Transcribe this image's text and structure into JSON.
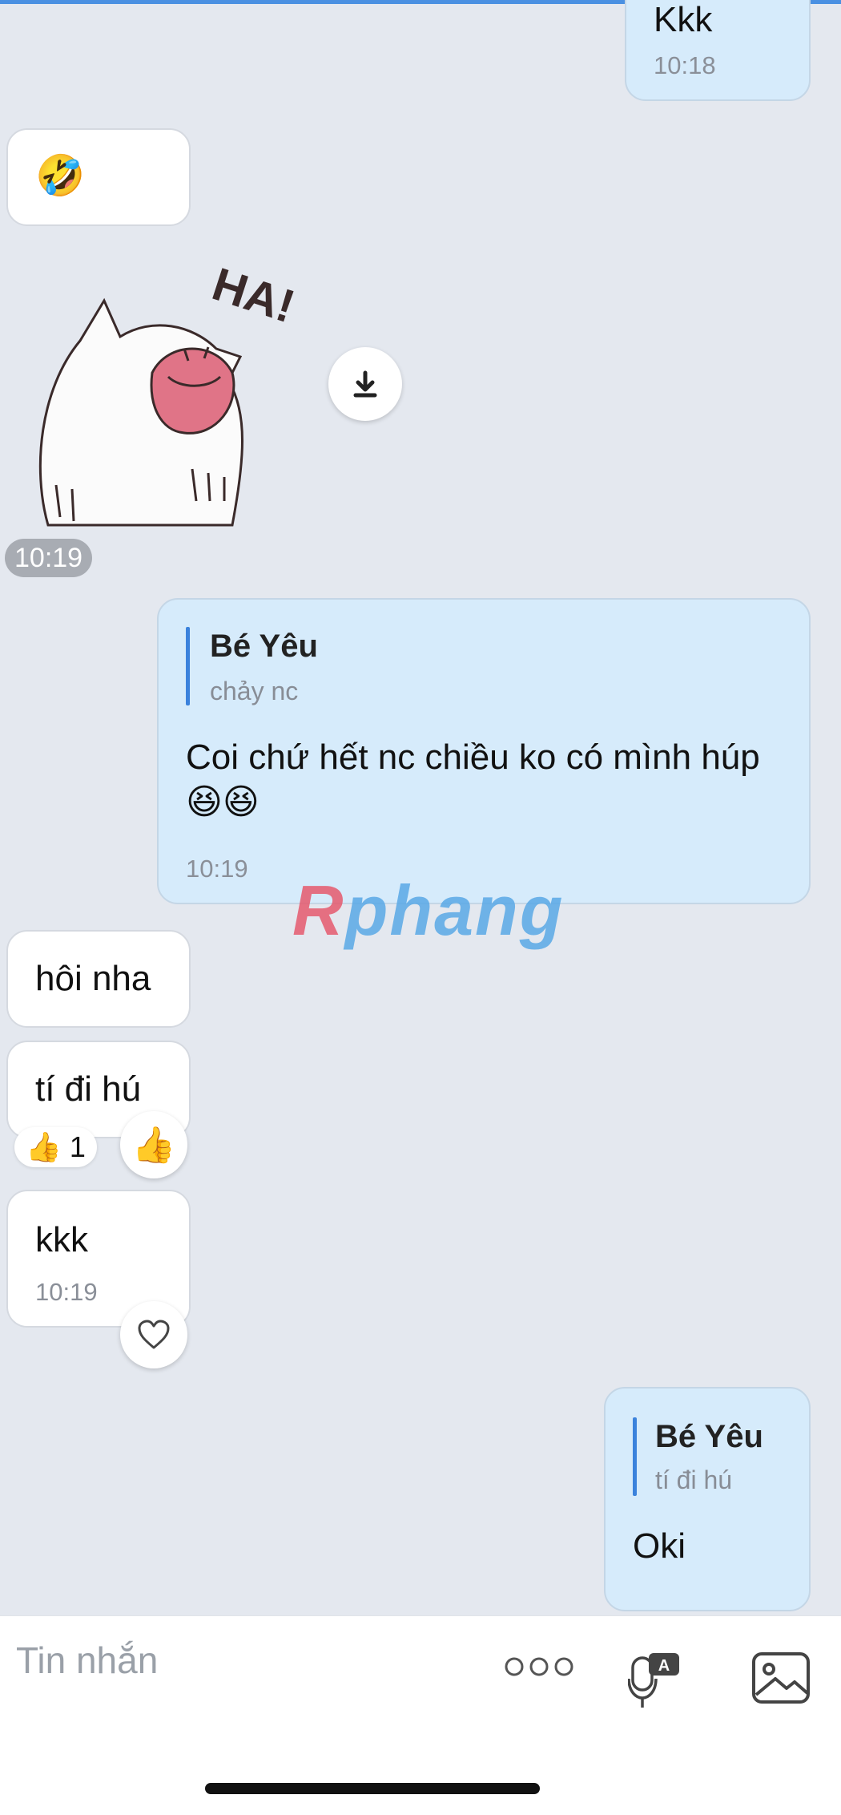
{
  "messages": {
    "m1": {
      "text": "Kkk",
      "time": "10:18"
    },
    "m2": {
      "emoji": "🤣"
    },
    "sticker": {
      "caption": "HA!",
      "time": "10:19"
    },
    "m3": {
      "quote_name": "Bé Yêu",
      "quote_text": "chảy nc",
      "text": "Coi chứ hết nc chiều ko có mình húp",
      "emoji": "😆😆",
      "time": "10:19"
    },
    "m4": {
      "text": "hôi nha"
    },
    "m5": {
      "text": "tí đi hú",
      "reaction_emoji": "👍",
      "reaction_count": "1",
      "react_button": "👍"
    },
    "m6": {
      "text": "kkk",
      "time": "10:19"
    },
    "m7": {
      "quote_name": "Bé Yêu",
      "quote_text": "tí đi hú",
      "text": "Oki"
    }
  },
  "watermark": {
    "part1": "R",
    "part2": "phang"
  },
  "composer": {
    "placeholder": "Tin nhắn"
  },
  "colors": {
    "background": "#e4e8ef",
    "outgoing_bubble": "#d6ebfb",
    "incoming_bubble": "#ffffff",
    "accent": "#3b82dc"
  }
}
